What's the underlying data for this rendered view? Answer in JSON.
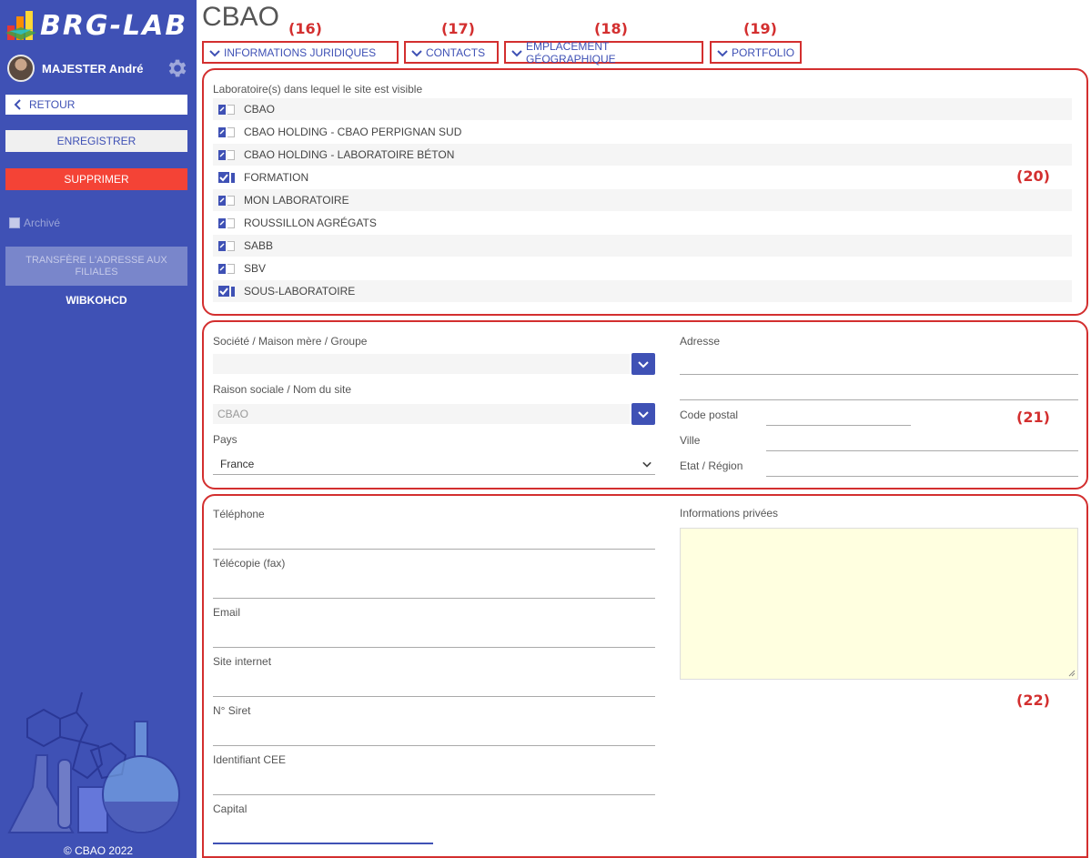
{
  "app": {
    "brand": "BRG-LAB",
    "copyright": "© CBAO 2022"
  },
  "user": {
    "name": "MAJESTER André"
  },
  "sidebar": {
    "back_label": "RETOUR",
    "save_label": "ENREGISTRER",
    "delete_label": "SUPPRIMER",
    "archive_label": "Archivé",
    "transfer_label": "TRANSFÈRE L'ADRESSE AUX FILIALES",
    "code": "WIBKOHCD"
  },
  "page": {
    "title": "CBAO"
  },
  "tabs": [
    {
      "label": "INFORMATIONS JURIDIQUES",
      "annotation": "(16)"
    },
    {
      "label": "CONTACTS",
      "annotation": "(17)"
    },
    {
      "label": "EMPLACEMENT GÉOGRAPHIQUE",
      "annotation": "(18)"
    },
    {
      "label": "PORTFOLIO",
      "annotation": "(19)"
    }
  ],
  "labs_section": {
    "label": "Laboratoire(s) dans lequel le site est visible",
    "annotation": "(20)",
    "items": [
      {
        "name": "CBAO",
        "checked": false
      },
      {
        "name": "CBAO HOLDING - CBAO PERPIGNAN SUD",
        "checked": false
      },
      {
        "name": "CBAO HOLDING - LABORATOIRE BÉTON",
        "checked": false
      },
      {
        "name": "FORMATION",
        "checked": true
      },
      {
        "name": "MON LABORATOIRE",
        "checked": false
      },
      {
        "name": "ROUSSILLON AGRÉGATS",
        "checked": false
      },
      {
        "name": "SABB",
        "checked": false
      },
      {
        "name": "SBV",
        "checked": false
      },
      {
        "name": "SOUS-LABORATOIRE",
        "checked": true
      }
    ]
  },
  "address_section": {
    "annotation": "(21)",
    "company_label": "Société / Maison mère / Groupe",
    "company_value": "",
    "raison_label": "Raison sociale / Nom du site",
    "raison_value": "CBAO",
    "country_label": "Pays",
    "country_value": "France",
    "address_label": "Adresse",
    "postal_label": "Code postal",
    "city_label": "Ville",
    "state_label": "Etat / Région"
  },
  "contact_section": {
    "annotation": "(22)",
    "phone_label": "Téléphone",
    "fax_label": "Télécopie (fax)",
    "email_label": "Email",
    "website_label": "Site internet",
    "siret_label": "N° Siret",
    "cee_label": "Identifiant CEE",
    "capital_label": "Capital",
    "private_label": "Informations privées"
  },
  "colors": {
    "primary": "#3f51b5",
    "danger": "#f44336",
    "annotation": "#d32f2f",
    "note_bg": "#ffffe0"
  }
}
